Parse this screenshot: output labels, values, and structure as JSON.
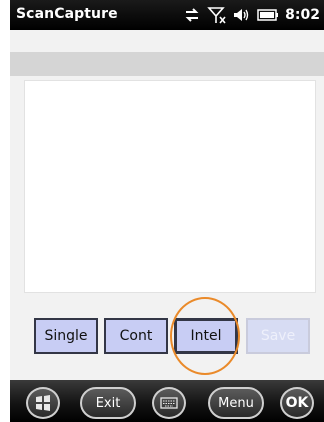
{
  "status_bar": {
    "app_title": "ScanCapture",
    "time": "8:02",
    "icons": [
      "sync-arrows-icon",
      "no-signal-icon",
      "speaker-icon",
      "battery-icon"
    ]
  },
  "scan_buttons": [
    {
      "label": "Single",
      "state": "normal"
    },
    {
      "label": "Cont",
      "state": "normal"
    },
    {
      "label": "Intel",
      "state": "active"
    },
    {
      "label": "Save",
      "state": "disabled"
    }
  ],
  "softkeys": {
    "start_icon": "windows-logo-icon",
    "exit_label": "Exit",
    "keyboard_icon": "keyboard-icon",
    "menu_label": "Menu",
    "ok_label": "OK"
  },
  "colors": {
    "button_fill": "#c8cdf4",
    "highlight_ring": "#ea8a2a",
    "status_bar": "#000000"
  }
}
